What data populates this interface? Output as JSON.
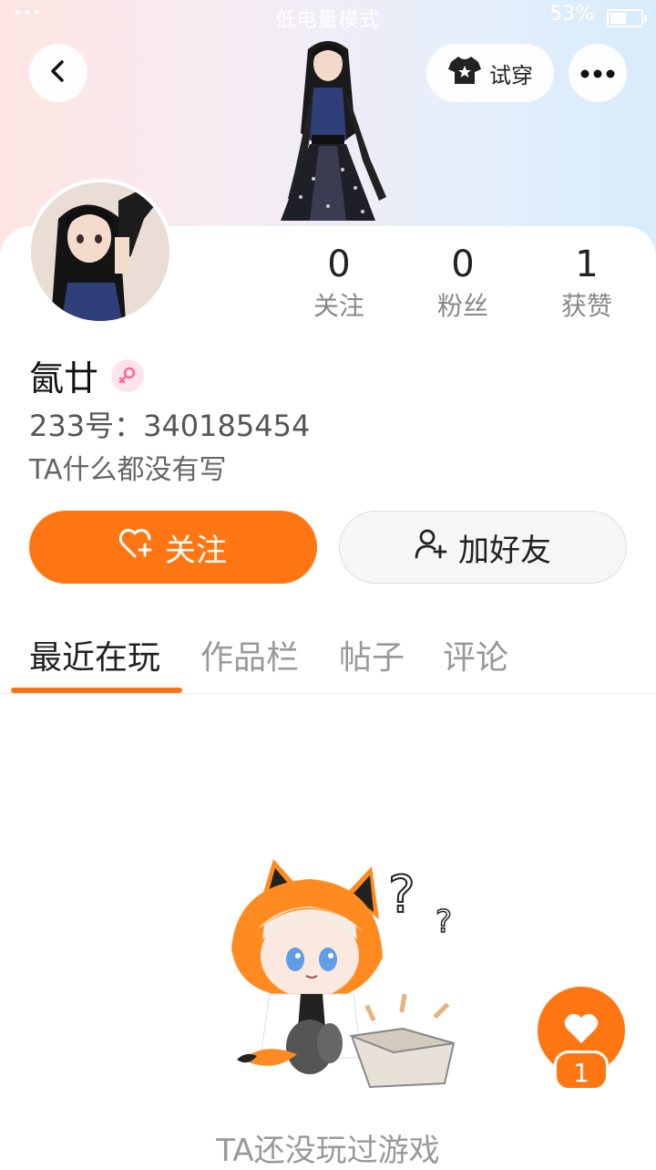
{
  "status_bar": {
    "left": "••• ",
    "mode": "低电量模式",
    "battery": "53%",
    "battery_level": 0.53
  },
  "header": {
    "back_icon": "chevron-left-icon",
    "try_label": "试穿",
    "try_icon": "shirt-star-icon",
    "more_icon": "ellipsis-icon"
  },
  "stats": [
    {
      "value": "0",
      "label": "关注"
    },
    {
      "value": "0",
      "label": "粉丝"
    },
    {
      "value": "1",
      "label": "获赞"
    }
  ],
  "profile": {
    "name": "氤廿",
    "gender_icon": "female-icon",
    "uid": "233号：340185454",
    "bio": "TA什么都没有写"
  },
  "actions": {
    "follow_label": "关注",
    "follow_icon": "heart-plus-icon",
    "add_friend_label": "加好友",
    "add_friend_icon": "user-plus-icon"
  },
  "tabs": [
    {
      "label": "最近在玩",
      "active": true
    },
    {
      "label": "作品栏",
      "active": false
    },
    {
      "label": "帖子",
      "active": false
    },
    {
      "label": "评论",
      "active": false
    }
  ],
  "empty_state": {
    "text": "TA还没玩过游戏",
    "illustration": "confused-mascot-with-empty-box"
  },
  "like_fab": {
    "icon": "heart-icon",
    "count": "1"
  },
  "colors": {
    "accent": "#ff7613",
    "gender_pink": "#f46b95"
  }
}
